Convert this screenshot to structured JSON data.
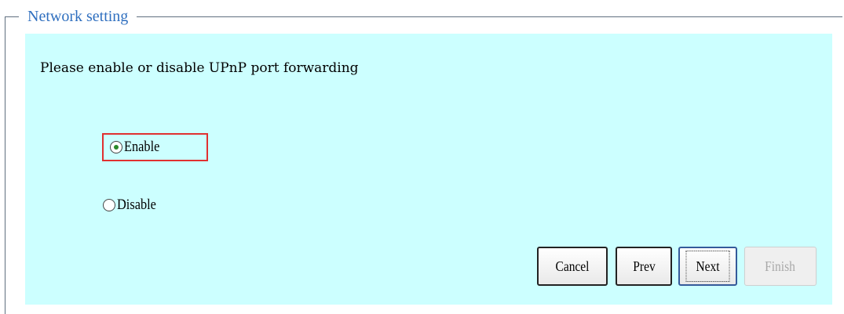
{
  "fieldset": {
    "legend": "Network setting"
  },
  "prompt": "Please enable or disable UPnP port forwarding",
  "options": [
    {
      "label": "Enable",
      "selected": true
    },
    {
      "label": "Disable",
      "selected": false
    }
  ],
  "buttons": {
    "cancel": "Cancel",
    "prev": "Prev",
    "next": "Next",
    "finish": "Finish"
  },
  "colors": {
    "panel_bg": "#ccffff",
    "legend_text": "#2f6fbf",
    "highlight_border": "#e03030",
    "radio_dot": "#2a8a2a"
  }
}
